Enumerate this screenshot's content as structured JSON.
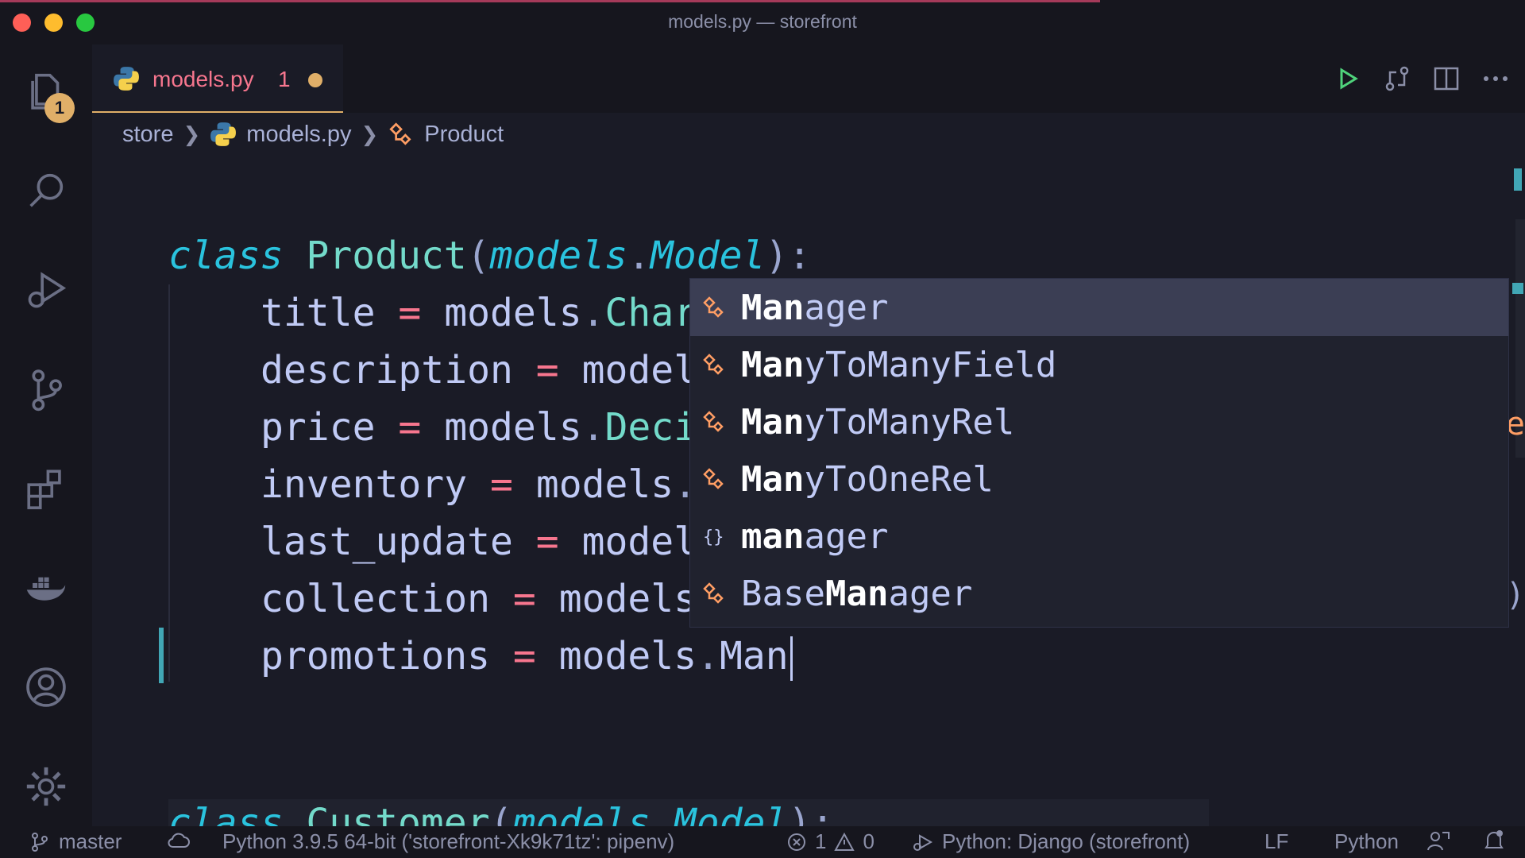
{
  "window": {
    "title": "models.py — storefront"
  },
  "activity_bar": {
    "explorer_badge": "1"
  },
  "tab": {
    "filename": "models.py",
    "problem_count": "1"
  },
  "breadcrumb": {
    "folder": "store",
    "file": "models.py",
    "symbol": "Product"
  },
  "editor": {
    "lines": [
      {
        "var": "",
        "rest": ""
      },
      {
        "var": "title",
        "eq": "=",
        "obj": "models",
        "dot": ".",
        "attr": "Char"
      },
      {
        "var": "description",
        "eq": "=",
        "obj": "model"
      },
      {
        "var": "price",
        "eq": "=",
        "obj": "models",
        "dot": ".",
        "attr": "Deci"
      },
      {
        "var": "inventory",
        "eq": "=",
        "obj": "models",
        "dot": "."
      },
      {
        "var": "last_update",
        "eq": "=",
        "obj": "model"
      },
      {
        "var": "collection",
        "eq": "=",
        "obj": "models"
      },
      {
        "var": "promotions",
        "eq": "=",
        "obj": "models",
        "dot": ".",
        "attr": "Man"
      }
    ],
    "class_line": {
      "keyword": "class",
      "name": "Product",
      "open": "(",
      "module": "models",
      "dot": ".",
      "base": "Model",
      "close": "):"
    },
    "next_class": {
      "keyword": "class",
      "name": "Customer",
      "open": "(",
      "module": "models",
      "dot": ".",
      "base": "Model",
      "close": "):"
    },
    "clipped_right_1": "e",
    "clipped_right_2": ")"
  },
  "suggestions": [
    {
      "match": "Man",
      "rest": "ager",
      "icon": "class-icon",
      "selected": true
    },
    {
      "match": "Man",
      "rest": "yToManyField",
      "icon": "class-icon"
    },
    {
      "match": "Man",
      "rest": "yToManyRel",
      "icon": "class-icon"
    },
    {
      "match": "Man",
      "rest": "yToOneRel",
      "icon": "class-icon"
    },
    {
      "match": "man",
      "rest": "ager",
      "icon": "module-icon"
    },
    {
      "prefix": "Base",
      "match": "Man",
      "rest": "ager",
      "icon": "class-icon"
    }
  ],
  "status_bar": {
    "branch": "master",
    "interpreter": "Python 3.9.5 64-bit ('storefront-Xk9k71tz': pipenv)",
    "errors": "1",
    "warnings": "0",
    "debug_config": "Python: Django (storefront)",
    "eol": "LF",
    "language": "Python"
  },
  "colors": {
    "accent": "#e0af68",
    "keyword": "#2ac3de",
    "classname": "#73daca",
    "operator": "#f7768e"
  }
}
